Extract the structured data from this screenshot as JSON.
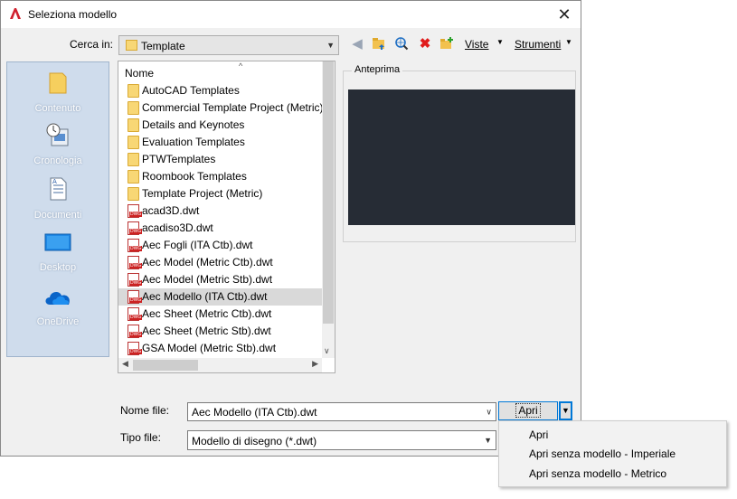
{
  "window": {
    "title": "Seleziona modello",
    "close_glyph": "✕",
    "app_icon": "autocad-logo-icon"
  },
  "lookin": {
    "label": "Cerca in:",
    "value": "Template"
  },
  "toolbar": {
    "icons": [
      "back-arrow-icon",
      "up-folder-icon",
      "search-web-icon",
      "delete-icon",
      "new-folder-icon"
    ],
    "views_label": "Viste",
    "tools_label": "Strumenti"
  },
  "places": [
    {
      "label": "Contenuto",
      "icon": "content-folder-icon"
    },
    {
      "label": "Cronologia",
      "icon": "history-icon"
    },
    {
      "label": "Documenti",
      "icon": "documents-icon"
    },
    {
      "label": "Desktop",
      "icon": "desktop-icon"
    },
    {
      "label": "OneDrive",
      "icon": "onedrive-cloud-icon"
    }
  ],
  "filelist": {
    "header": "Nome",
    "selected": "Aec Modello (ITA Ctb).dwt",
    "items": [
      {
        "name": "AutoCAD Templates",
        "type": "folder"
      },
      {
        "name": "Commercial Template Project (Metric)",
        "type": "folder"
      },
      {
        "name": "Details and Keynotes",
        "type": "folder"
      },
      {
        "name": "Evaluation Templates",
        "type": "folder"
      },
      {
        "name": "PTWTemplates",
        "type": "folder"
      },
      {
        "name": "Roombook Templates",
        "type": "folder"
      },
      {
        "name": "Template Project (Metric)",
        "type": "folder"
      },
      {
        "name": "acad3D.dwt",
        "type": "dwt"
      },
      {
        "name": "acadiso3D.dwt",
        "type": "dwt"
      },
      {
        "name": "Aec Fogli (ITA Ctb).dwt",
        "type": "dwt"
      },
      {
        "name": "Aec Model (Metric Ctb).dwt",
        "type": "dwt"
      },
      {
        "name": "Aec Model (Metric Stb).dwt",
        "type": "dwt"
      },
      {
        "name": "Aec Modello (ITA Ctb).dwt",
        "type": "dwt"
      },
      {
        "name": "Aec Sheet (Metric Ctb).dwt",
        "type": "dwt"
      },
      {
        "name": "Aec Sheet (Metric Stb).dwt",
        "type": "dwt"
      },
      {
        "name": "GSA Model (Metric Stb).dwt",
        "type": "dwt"
      }
    ]
  },
  "preview": {
    "label": "Anteprima"
  },
  "filename": {
    "label": "Nome file:",
    "value": "Aec Modello (ITA Ctb).dwt"
  },
  "filetype": {
    "label": "Tipo file:",
    "value": "Modello di disegno (*.dwt)"
  },
  "open_button": {
    "label": "Apri"
  },
  "open_menu": {
    "items": [
      "Apri",
      "Apri senza modello - Imperiale",
      "Apri senza modello - Metrico"
    ]
  },
  "colors": {
    "accent": "#0078d7",
    "places_bg": "#cfdcec",
    "preview_bg": "#262c35",
    "app_red": "#d0202e"
  }
}
